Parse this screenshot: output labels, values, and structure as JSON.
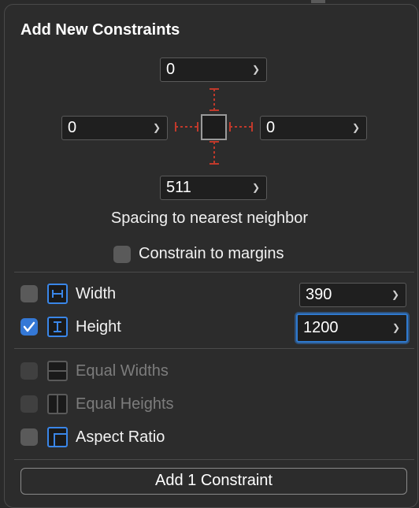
{
  "title": "Add New Constraints",
  "spacing": {
    "top": "0",
    "left": "0",
    "right": "0",
    "bottom": "511",
    "caption": "Spacing to nearest neighbor"
  },
  "constrain_to_margins": {
    "label": "Constrain to margins",
    "checked": false
  },
  "width": {
    "label": "Width",
    "checked": false,
    "value": "390"
  },
  "height": {
    "label": "Height",
    "checked": true,
    "value": "1200"
  },
  "equal_widths": {
    "label": "Equal Widths",
    "checked": false,
    "enabled": false
  },
  "equal_heights": {
    "label": "Equal Heights",
    "checked": false,
    "enabled": false
  },
  "aspect_ratio": {
    "label": "Aspect Ratio",
    "checked": false
  },
  "add_button": {
    "label": "Add 1 Constraint"
  },
  "colors": {
    "accent": "#3478d6",
    "strut": "#c0392b"
  }
}
